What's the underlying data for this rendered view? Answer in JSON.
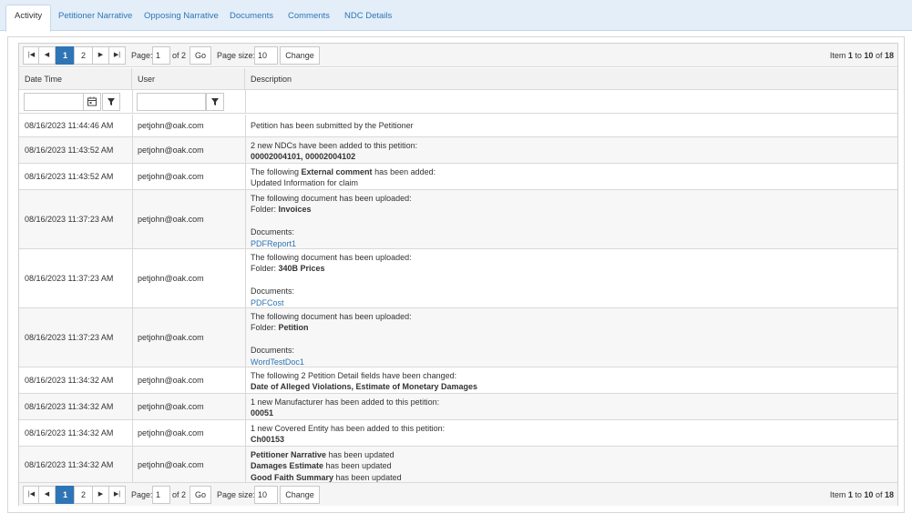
{
  "tabs": [
    {
      "label": "Activity",
      "active": true
    },
    {
      "label": "Petitioner Narrative"
    },
    {
      "label": "Opposing Narrative"
    },
    {
      "label": "Documents"
    },
    {
      "label": "Comments"
    },
    {
      "label": "NDC Details"
    }
  ],
  "pager": {
    "first_icon": "first-page-icon",
    "prev_icon": "previous-page-icon",
    "next_icon": "next-page-icon",
    "last_icon": "last-page-icon",
    "pages": [
      "1",
      "2"
    ],
    "current_page": "1",
    "page_label": "Page:",
    "page_value": "1",
    "of_label": "of 2",
    "go_label": "Go",
    "size_label": "Page size:",
    "size_value": "10",
    "change_label": "Change",
    "info_item": "Item",
    "info_from": "1",
    "info_to_word": "to",
    "info_to": "10",
    "info_of_word": "of",
    "info_total": "18"
  },
  "columns": {
    "datetime": "Date Time",
    "user": "User",
    "description": "Description"
  },
  "filters": {
    "calendar_icon": "calendar-icon",
    "filter_icon": "filter-icon"
  },
  "colors": {
    "accent": "#2f75b5",
    "tabbar": "#e3eef9"
  },
  "rows": [
    {
      "datetime": "08/16/2023 11:44:46 AM",
      "user": "petjohn@oak.com",
      "lines": [
        [
          {
            "t": "Petition has been submitted by the Petitioner"
          }
        ]
      ]
    },
    {
      "datetime": "08/16/2023 11:43:52 AM",
      "user": "petjohn@oak.com",
      "lines": [
        [
          {
            "t": "2 new NDCs have been added to this petition:"
          }
        ],
        [
          {
            "t": "00002004101, 00002004102",
            "b": true
          }
        ]
      ]
    },
    {
      "datetime": "08/16/2023 11:43:52 AM",
      "user": "petjohn@oak.com",
      "lines": [
        [
          {
            "t": "The following "
          },
          {
            "t": "External comment",
            "b": true
          },
          {
            "t": " has been added:"
          }
        ],
        [
          {
            "t": "Updated Information for claim"
          }
        ]
      ]
    },
    {
      "datetime": "08/16/2023 11:37:23 AM",
      "user": "petjohn@oak.com",
      "lines": [
        [
          {
            "t": "The following document has been uploaded:"
          }
        ],
        [
          {
            "t": "Folder: "
          },
          {
            "t": "Invoices",
            "b": true
          }
        ],
        [],
        [
          {
            "t": "Documents:"
          }
        ],
        [
          {
            "t": "PDFReport1",
            "link": true
          }
        ]
      ]
    },
    {
      "datetime": "08/16/2023 11:37:23 AM",
      "user": "petjohn@oak.com",
      "lines": [
        [
          {
            "t": "The following document has been uploaded:"
          }
        ],
        [
          {
            "t": "Folder: "
          },
          {
            "t": "340B Prices",
            "b": true
          }
        ],
        [],
        [
          {
            "t": "Documents:"
          }
        ],
        [
          {
            "t": "PDFCost",
            "link": true
          }
        ]
      ]
    },
    {
      "datetime": "08/16/2023 11:37:23 AM",
      "user": "petjohn@oak.com",
      "lines": [
        [
          {
            "t": "The following document has been uploaded:"
          }
        ],
        [
          {
            "t": "Folder: "
          },
          {
            "t": "Petition",
            "b": true
          }
        ],
        [],
        [
          {
            "t": "Documents:"
          }
        ],
        [
          {
            "t": "WordTestDoc1",
            "link": true
          }
        ]
      ]
    },
    {
      "datetime": "08/16/2023 11:34:32 AM",
      "user": "petjohn@oak.com",
      "lines": [
        [
          {
            "t": "The following 2 Petition Detail fields have been changed:"
          }
        ],
        [
          {
            "t": "Date of Alleged Violations, Estimate of Monetary Damages",
            "b": true
          }
        ]
      ]
    },
    {
      "datetime": "08/16/2023 11:34:32 AM",
      "user": "petjohn@oak.com",
      "lines": [
        [
          {
            "t": "1 new Manufacturer has been added to this petition:"
          }
        ],
        [
          {
            "t": "00051",
            "b": true
          }
        ]
      ]
    },
    {
      "datetime": "08/16/2023 11:34:32 AM",
      "user": "petjohn@oak.com",
      "lines": [
        [
          {
            "t": "1 new Covered Entity has been added to this petition:"
          }
        ],
        [
          {
            "t": "Ch00153",
            "b": true
          }
        ]
      ]
    },
    {
      "datetime": "08/16/2023 11:34:32 AM",
      "user": "petjohn@oak.com",
      "lines": [
        [
          {
            "t": "Petitioner Narrative",
            "b": true
          },
          {
            "t": " has been updated"
          }
        ],
        [
          {
            "t": "Damages Estimate",
            "b": true
          },
          {
            "t": " has been updated"
          }
        ],
        [
          {
            "t": "Good Faith Summary",
            "b": true
          },
          {
            "t": " has been updated"
          }
        ]
      ]
    }
  ]
}
